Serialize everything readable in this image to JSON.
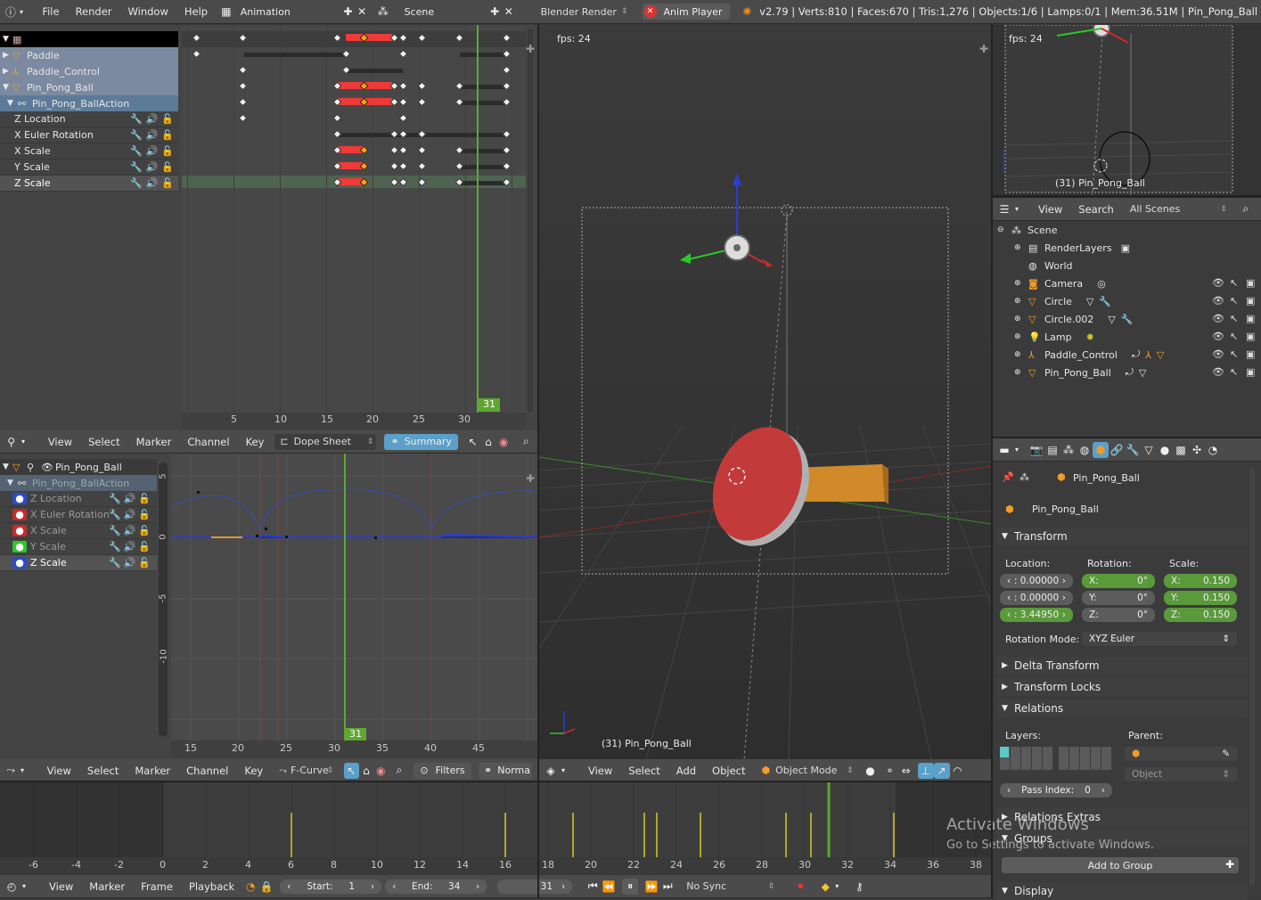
{
  "topbar": {
    "menus": [
      "File",
      "Render",
      "Window",
      "Help"
    ],
    "layout": "Animation",
    "scene": "Scene",
    "engine": "Blender Render",
    "anim_player": "Anim Player",
    "stats": "v2.79 | Verts:810 | Faces:670 | Tris:1,276 | Objects:1/6 | Lamps:0/1 | Mem:36.51M | Pin_Pong_Ball"
  },
  "dopesheet": {
    "channels": [
      "Paddle",
      "Paddle_Control",
      "Pin_Pong_Ball",
      "Pin_Pong_BallAction",
      "Z Location",
      "X Euler Rotation",
      "X Scale",
      "Y Scale",
      "Z Scale"
    ],
    "ticks": [
      "5",
      "10",
      "15",
      "20",
      "25",
      "30"
    ],
    "current_frame": "31",
    "header": {
      "menus": [
        "View",
        "Select",
        "Marker",
        "Channel",
        "Key"
      ],
      "mode": "Dope Sheet",
      "summary": "Summary"
    }
  },
  "graph": {
    "object": "Pin_Pong_Ball",
    "action": "Pin_Pong_BallAction",
    "channels": [
      "Z Location",
      "X Euler Rotation",
      "X Scale",
      "Y Scale",
      "Z Scale"
    ],
    "yticks": [
      "5",
      "0",
      "-5",
      "-10"
    ],
    "xticks": [
      "15",
      "20",
      "25",
      "30",
      "35",
      "40",
      "45"
    ],
    "current_frame": "31",
    "header": {
      "menus": [
        "View",
        "Select",
        "Marker",
        "Channel",
        "Key"
      ],
      "mode": "F-Curve",
      "filters": "Filters",
      "normalize": "Norma"
    }
  },
  "viewport": {
    "fps": "fps: 24",
    "object_label": "(31) Pin_Pong_Ball",
    "header": {
      "menus": [
        "View",
        "Select",
        "Add",
        "Object"
      ],
      "mode": "Object Mode"
    }
  },
  "camview": {
    "fps": "fps: 24",
    "object_label": "(31) Pin_Pong_Ball"
  },
  "outliner": {
    "menus": [
      "View",
      "Search"
    ],
    "filter": "All Scenes",
    "items": [
      "Scene",
      "RenderLayers",
      "World",
      "Camera",
      "Circle",
      "Circle.002",
      "Lamp",
      "Paddle_Control",
      "Pin_Pong_Ball"
    ]
  },
  "properties": {
    "object_path": "Pin_Pong_Ball",
    "object_name": "Pin_Pong_Ball",
    "transform": "Transform",
    "location_label": "Location:",
    "rotation_label": "Rotation:",
    "scale_label": "Scale:",
    "location": [
      ":  0.00000",
      ":  0.00000",
      ":  3.44950"
    ],
    "rotation": [
      {
        "axis": "X:",
        "value": "0°"
      },
      {
        "axis": "Y:",
        "value": "0°"
      },
      {
        "axis": "Z:",
        "value": "0°"
      }
    ],
    "scale": [
      {
        "axis": "X:",
        "value": "0.150"
      },
      {
        "axis": "Y:",
        "value": "0.150"
      },
      {
        "axis": "Z:",
        "value": "0.150"
      }
    ],
    "rotation_mode_label": "Rotation Mode:",
    "rotation_mode": "XYZ Euler",
    "delta": "Delta Transform",
    "locks": "Transform Locks",
    "relations": "Relations",
    "layers_label": "Layers:",
    "parent_label": "Parent:",
    "parent_type": "Object",
    "pass_index_label": "Pass Index:",
    "pass_index": "0",
    "relations_extras": "Relations Extras",
    "groups": "Groups",
    "add_group": "Add to Group",
    "display": "Display"
  },
  "timeline": {
    "ticks": [
      "-6",
      "-4",
      "-2",
      "0",
      "2",
      "4",
      "6",
      "8",
      "10",
      "12",
      "14",
      "16",
      "18",
      "20",
      "22",
      "24",
      "26",
      "28",
      "30",
      "32",
      "34",
      "36",
      "38"
    ],
    "menus": [
      "View",
      "Marker",
      "Frame",
      "Playback"
    ],
    "start_label": "Start:",
    "start": "1",
    "end_label": "End:",
    "end": "34",
    "current": "31",
    "sync": "No Sync"
  },
  "watermark": {
    "title": "Activate Windows",
    "sub": "Go to Settings to activate Windows."
  }
}
